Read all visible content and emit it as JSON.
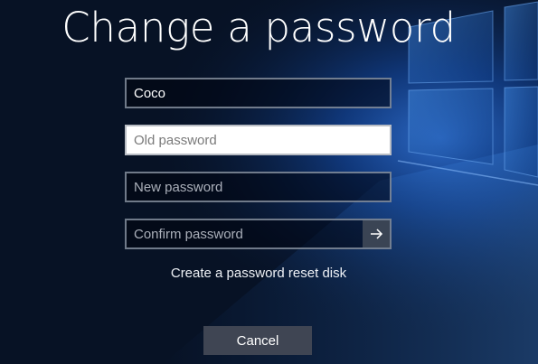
{
  "title": "Change a password",
  "fields": {
    "username": {
      "value": "Coco"
    },
    "old_password": {
      "placeholder": "Old password",
      "value": ""
    },
    "new_password": {
      "placeholder": "New password",
      "value": ""
    },
    "confirm_password": {
      "placeholder": "Confirm password",
      "value": ""
    }
  },
  "submit_icon": "arrow-right-icon",
  "reset_disk_link": "Create a password reset disk",
  "cancel_label": "Cancel",
  "colors": {
    "background": "#071225",
    "accent_glow": "#4a8fe0",
    "button_bg": "#3f4553",
    "submit_bg": "#3a4454"
  }
}
